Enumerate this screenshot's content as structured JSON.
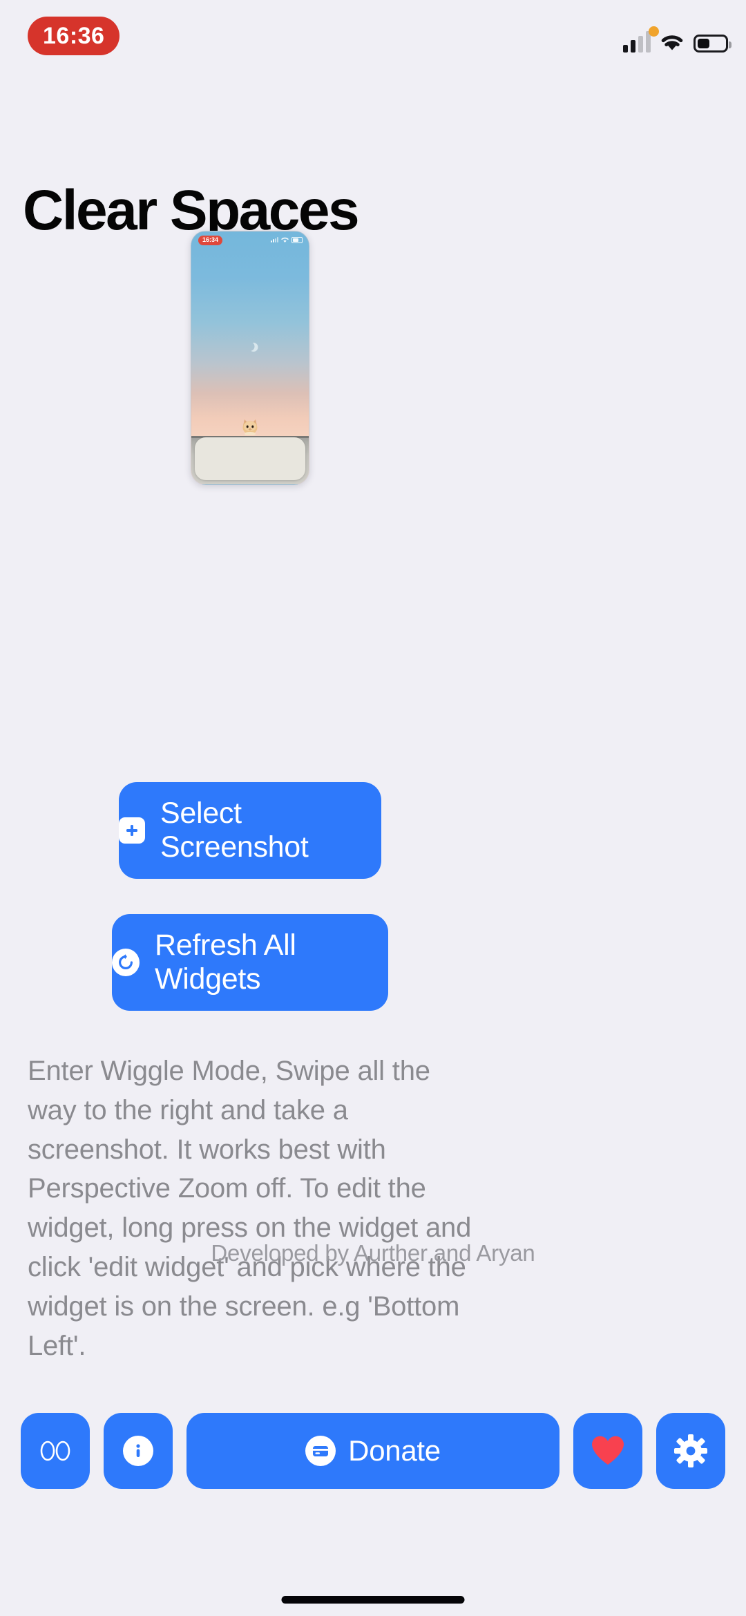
{
  "status_bar": {
    "time": "16:36",
    "time_pill_color": "#D6342B",
    "mic_indicator": "orange-dot",
    "cellular_bars_filled": 2,
    "cellular_bars_total": 4,
    "wifi": "wifi-full",
    "battery_percent": 38
  },
  "header": {
    "title": "Clear Spaces"
  },
  "preview": {
    "alt_label": "screenshot-preview",
    "phone_time": "16:34",
    "wallpaper": "sky-gradient-with-cat",
    "widget_placeholder": "blank-widget-card"
  },
  "actions": {
    "select_screenshot": {
      "label": "Select Screenshot",
      "icon": "plus-square-icon"
    },
    "refresh_widgets": {
      "label": "Refresh All Widgets",
      "icon": "refresh-circle-icon"
    },
    "accent_color": "#2E79FB"
  },
  "description": {
    "text": "Enter Wiggle Mode, Swipe all the way to the right and take a screenshot. It works best with Perspective Zoom off. To edit the widget, long press on the widget and click 'edit widget' and pick where the widget is on the screen. e.g 'Bottom Left'."
  },
  "credit": {
    "text": "Developed by Aurther and Aryan"
  },
  "toolbar": {
    "items": [
      {
        "name": "preview",
        "icon": "eyes-icon",
        "label": ""
      },
      {
        "name": "info",
        "icon": "info-circle-icon",
        "label": ""
      },
      {
        "name": "donate",
        "icon": "credit-card-icon",
        "label": "Donate"
      },
      {
        "name": "favorite",
        "icon": "heart-icon",
        "label": ""
      },
      {
        "name": "settings",
        "icon": "gear-icon",
        "label": ""
      }
    ],
    "donate_label": "Donate",
    "heart_color": "#F8414F",
    "button_color": "#2E79FB"
  },
  "home_indicator": {
    "label": "home-indicator"
  }
}
